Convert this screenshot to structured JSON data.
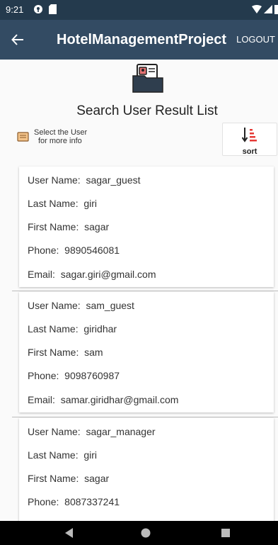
{
  "status_bar": {
    "time": "9:21",
    "icons": [
      "vpn-key-icon",
      "sd-card-icon",
      "wifi-icon",
      "signal-icon",
      "battery-icon"
    ]
  },
  "app_bar": {
    "title": "HotelManagementProject",
    "logout_label": "LOGOUT",
    "back_icon": "arrow-left-icon",
    "background": "#334b63"
  },
  "header": {
    "icon": "user-folder-icon",
    "title": "Search User Result List"
  },
  "hint": {
    "icon": "note-icon",
    "line1": "Select the User",
    "line2": "for more info"
  },
  "sort": {
    "icon": "sort-descending-icon",
    "label": "sort"
  },
  "labels": {
    "user_name": "User Name:",
    "last_name": "Last Name:",
    "first_name": "First Name:",
    "phone": "Phone:",
    "email": "Email:"
  },
  "users": [
    {
      "user_name": "sagar_guest",
      "last_name": "giri",
      "first_name": "sagar",
      "phone": "9890546081",
      "email": "sagar.giri@gmail.com"
    },
    {
      "user_name": "sam_guest",
      "last_name": "giridhar",
      "first_name": "sam",
      "phone": "9098760987",
      "email": "samar.giridhar@gmail.com"
    },
    {
      "user_name": "sagar_manager",
      "last_name": "giri",
      "first_name": "sagar",
      "phone": "8087337241"
    }
  ],
  "nav_bar": {
    "icons": [
      "back-triangle-icon",
      "home-circle-icon",
      "recents-square-icon"
    ]
  }
}
